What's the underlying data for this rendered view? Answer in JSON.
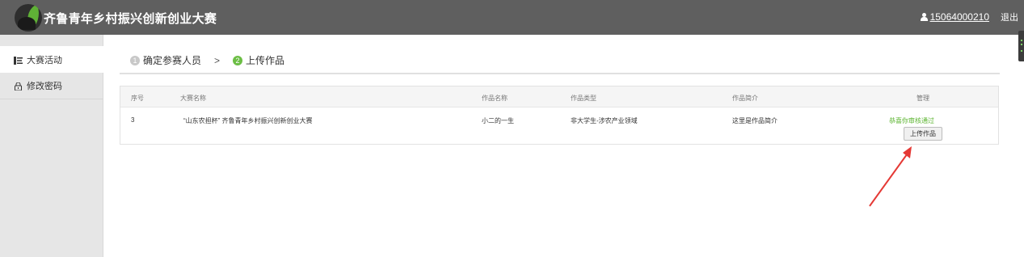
{
  "header": {
    "title": "齐鲁青年乡村振兴创新创业大赛",
    "user_phone": "15064000210",
    "logout_label": "退出",
    "background_color": "#5f5f5f"
  },
  "sidebar": {
    "items": [
      {
        "label": "大赛活动",
        "icon": "list-icon",
        "active": true
      },
      {
        "label": "修改密码",
        "icon": "lock-icon",
        "active": false
      }
    ]
  },
  "steps": {
    "items": [
      {
        "number": "1",
        "label": "确定参赛人员",
        "status": "done"
      },
      {
        "number": "2",
        "label": "上传作品",
        "status": "current"
      }
    ],
    "separator": ">"
  },
  "table": {
    "columns": [
      "序号",
      "大赛名称",
      "作品名称",
      "作品类型",
      "作品简介",
      "管理"
    ],
    "rows": [
      {
        "index": "3",
        "contest": "“山东农担杯” 齐鲁青年乡村振兴创新创业大赛",
        "work_name": "小二的一生",
        "work_type": "非大学生-涉农产业领域",
        "intro": "这里是作品简介",
        "status": "恭喜你审核通过",
        "action_label": "上传作品"
      }
    ]
  },
  "colors": {
    "accent_green": "#6cbe45",
    "status_green": "#5cb531",
    "arrow_red": "#e53935"
  }
}
